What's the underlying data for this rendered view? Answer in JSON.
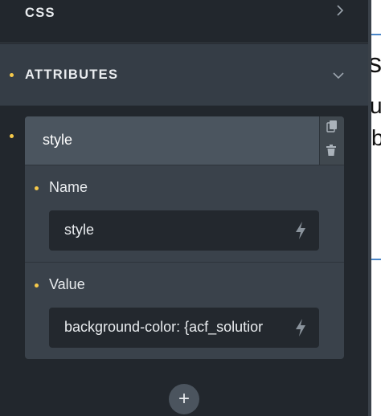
{
  "sections": {
    "css_label": "CSS",
    "attributes_label": "ATTRIBUTES"
  },
  "attribute_item": {
    "title": "style",
    "name_label": "Name",
    "name_value": "style",
    "value_label": "Value",
    "value_value": "background-color: {acf_solutior"
  },
  "icons": {
    "css_chevron": "chevron-right-icon",
    "attributes_chevron": "chevron-down-icon",
    "copy": "copy-icon",
    "trash": "trash-icon",
    "dynamic_data": "bolt-icon",
    "add": "plus-icon"
  },
  "background_text": {
    "a": "s",
    "b": "u",
    "c": "b"
  },
  "colors": {
    "panel": "#22272d",
    "accent_dot": "#f6c94a",
    "section_active": "#353d46"
  }
}
